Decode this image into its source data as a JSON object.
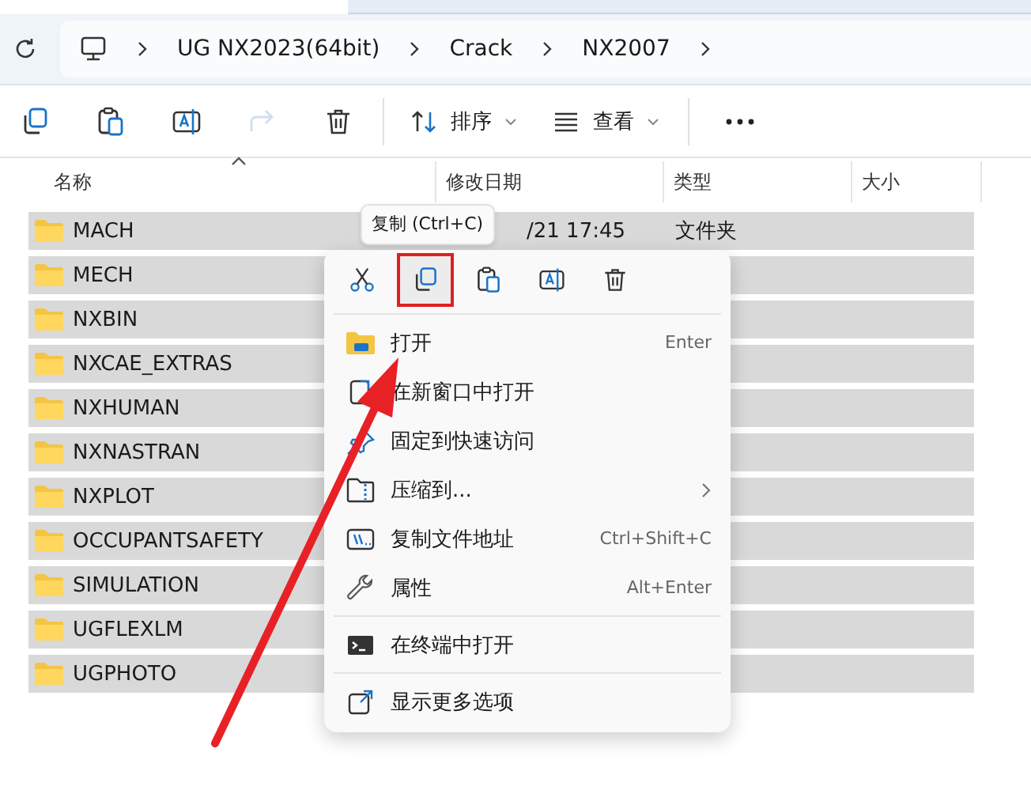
{
  "address_bar": {
    "segments": [
      "UG NX2023(64bit)",
      "Crack",
      "NX2007"
    ]
  },
  "toolbar": {
    "buttons": [
      {
        "kind": "copy",
        "disabled": false
      },
      {
        "kind": "paste",
        "disabled": false
      },
      {
        "kind": "rename",
        "disabled": false
      },
      {
        "kind": "share",
        "disabled": true
      },
      {
        "kind": "delete",
        "disabled": false
      }
    ],
    "sort_label": "排序",
    "view_label": "查看"
  },
  "columns": [
    {
      "label": "名称",
      "sorted": true
    },
    {
      "label": "修改日期",
      "sorted": false
    },
    {
      "label": "类型",
      "sorted": false
    },
    {
      "label": "大小",
      "sorted": false
    }
  ],
  "rows": [
    {
      "name": "MACH",
      "date": "/21 17:45",
      "type": "文件夹",
      "selected": true
    },
    {
      "name": "MECH",
      "selected": true
    },
    {
      "name": "NXBIN",
      "selected": true
    },
    {
      "name": "NXCAE_EXTRAS",
      "selected": true
    },
    {
      "name": "NXHUMAN",
      "selected": true
    },
    {
      "name": "NXNASTRAN",
      "selected": true
    },
    {
      "name": "NXPLOT",
      "selected": true
    },
    {
      "name": "OCCUPANTSAFETY",
      "selected": true
    },
    {
      "name": "SIMULATION",
      "selected": true
    },
    {
      "name": "UGFLEXLM",
      "selected": true
    },
    {
      "name": "UGPHOTO",
      "selected": true
    }
  ],
  "context_menu": {
    "tooltip": "复制 (Ctrl+C)",
    "quick_actions": [
      {
        "kind": "cut",
        "highlighted": false
      },
      {
        "kind": "copy",
        "highlighted": true
      },
      {
        "kind": "paste",
        "highlighted": false
      },
      {
        "kind": "rename",
        "highlighted": false
      },
      {
        "kind": "delete",
        "highlighted": false
      }
    ],
    "sections": [
      [
        {
          "kind": "open",
          "label": "打开",
          "shortcut": "Enter"
        },
        {
          "kind": "new-window",
          "label": "在新窗口中打开"
        },
        {
          "kind": "pin",
          "label": "固定到快速访问"
        },
        {
          "kind": "zip",
          "label": "压缩到...",
          "submenu": true
        },
        {
          "kind": "copy-path",
          "label": "复制文件地址",
          "shortcut": "Ctrl+Shift+C"
        },
        {
          "kind": "properties",
          "label": "属性",
          "shortcut": "Alt+Enter"
        }
      ],
      [
        {
          "kind": "terminal",
          "label": "在终端中打开"
        }
      ],
      [
        {
          "kind": "more",
          "label": "显示更多选项"
        }
      ]
    ]
  }
}
